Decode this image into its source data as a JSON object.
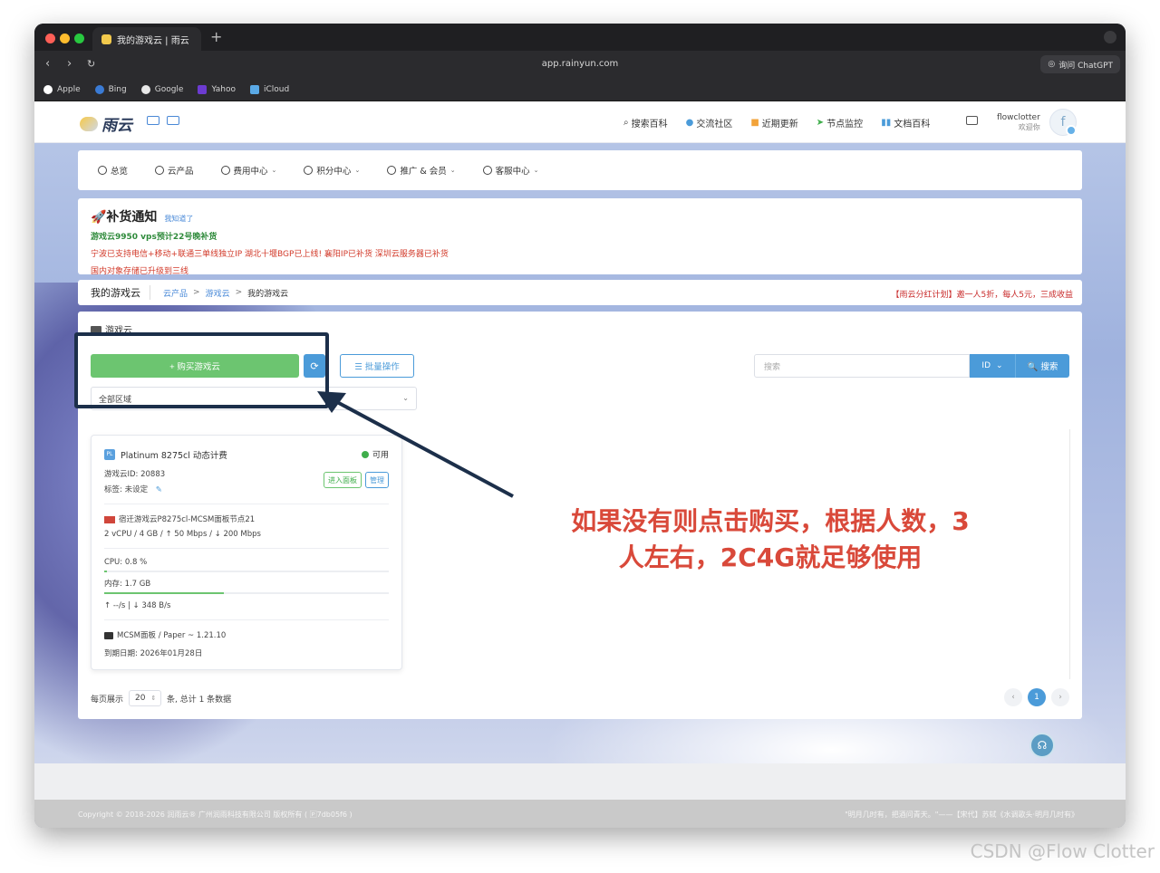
{
  "browser": {
    "tab_title": "我的游戏云 | 雨云",
    "new_tab": "+",
    "url": "app.rainyun.com",
    "chatgpt_button": "询问 ChatGPT",
    "bookmarks": [
      "Apple",
      "Bing",
      "Google",
      "Yahoo",
      "iCloud"
    ]
  },
  "site": {
    "logo_text": "雨云",
    "nav": [
      "搜索百科",
      "交流社区",
      "近期更新",
      "节点监控",
      "文档百科"
    ],
    "user_name": "flowclotter",
    "user_welcome": "欢迎你",
    "avatar_letter": "f"
  },
  "menu": {
    "items": [
      "总览",
      "云产品",
      "费用中心",
      "积分中心",
      "推广 & 会员",
      "客服中心"
    ],
    "caret": "⌄"
  },
  "notice": {
    "title": "🚀补货通知",
    "tag": "我知道了",
    "line1": "游戏云9950 vps预计22号晚补货",
    "line2": "宁波已支持电信+移动+联通三单线独立IP 湖北十堰BGP已上线! 襄阳IP已补货 深圳云服务器已补货",
    "line3": "国内对象存储已升级到三线"
  },
  "breadcrumb": {
    "page_title": "我的游戏云",
    "items": [
      "云产品",
      "游戏云",
      "我的游戏云"
    ],
    "sep": ">",
    "promo": "【雨云分红计划】邀一人5折，每人5元，三成收益"
  },
  "main": {
    "section_title": "游戏云",
    "buy_button": "+ 购买游戏云",
    "refresh_icon": "⟳",
    "batch_button": "☰ 批量操作",
    "region_select": "全部区域",
    "search_placeholder": "搜索",
    "search_field": "ID",
    "search_button": "🔍 搜索"
  },
  "game_card": {
    "badge": "PL",
    "name": "Platinum 8275cl 动态计费",
    "status": "可用",
    "id_line": "游戏云ID: 20883",
    "tag_line": "标签: 未设定",
    "enter_panel": "进入面板",
    "manage": "管理",
    "node": "宿迁游戏云P8275cl-MCSM面板节点21",
    "spec": "2 vCPU / 4 GB / ↑ 50 Mbps / ↓ 200 Mbps",
    "cpu": "CPU:  0.8 %",
    "cpu_usage": 0.8,
    "mem": "内存:  1.7 GB",
    "mem_usage_fraction": 0.42,
    "net": "↑  --/s   |   ↓   348 B/s",
    "panel": "MCSM面板 / Paper ~ 1.21.10",
    "expiry": "到期日期:  2026年01月28日"
  },
  "pagination": {
    "per_page_label": "每页展示",
    "per_page_value": "20",
    "total": "条, 总计 1 条数据",
    "prev": "‹",
    "current": "1",
    "next": "›"
  },
  "footer": {
    "copyright": "Copyright © 2018-2026 润雨云® 广州润雨科技有限公司 版权所有 ( 🄿7db05f6 )",
    "quote": "\"明月几时有，把酒问青天。\"——【宋代】苏轼《水调歌头·明月几时有》"
  },
  "annotation": {
    "line1": "如果没有则点击购买，根据人数，3",
    "line2": "人左右，2C4G就足够使用"
  },
  "watermark": "CSDN @Flow Clotter",
  "colors": {
    "primary": "#4b9bd9",
    "success": "#6cc570",
    "annotation": "#d9493a",
    "highlight_border": "#1c2f4a"
  }
}
